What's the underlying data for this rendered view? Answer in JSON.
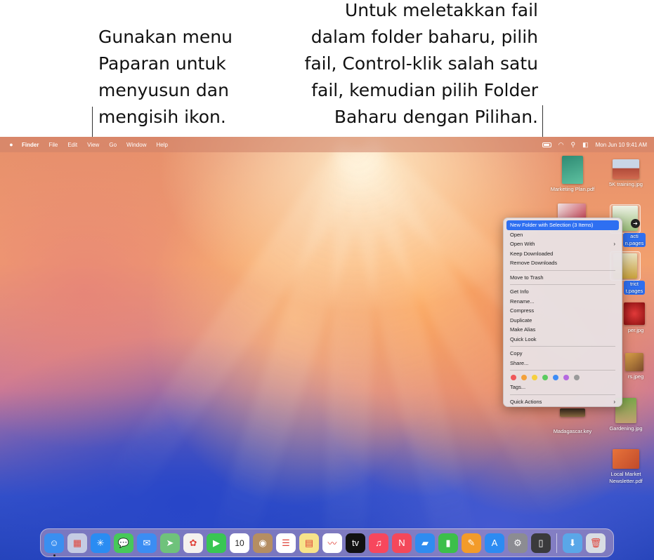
{
  "callouts": {
    "left": "Gunakan menu\nPaparan untuk\nmenyusun dan\nmengisih ikon.",
    "right": "Untuk meletakkan fail\ndalam folder baharu, pilih\nfail, Control-klik salah satu\nfail, kemudian pilih Folder\nBaharu dengan Pilihan."
  },
  "menubar": {
    "apple_icon": "apple-logo-icon",
    "items": [
      "Finder",
      "File",
      "Edit",
      "View",
      "Go",
      "Window",
      "Help"
    ],
    "status_icons": [
      "battery-icon",
      "wifi-icon",
      "spotlight-search-icon",
      "control-center-icon"
    ],
    "clock": "Mon Jun 10  9:41 AM"
  },
  "desktop_icons": [
    {
      "label": "Marketing Plan.pdf",
      "selected": false
    },
    {
      "label": "5K training.jpg",
      "selected": false
    },
    {
      "label": "acti\nn.pages",
      "selected": true
    },
    {
      "label": "trict\nt.pages",
      "selected": true
    },
    {
      "label": "per.jpg",
      "selected": false
    },
    {
      "label": "rs.jpeg",
      "selected": false
    },
    {
      "label": "Madagascar.key",
      "selected": false
    },
    {
      "label": "Gardening.jpg",
      "selected": false
    },
    {
      "label": "Local Market\nNewsletter.pdf",
      "selected": false
    }
  ],
  "context_menu": {
    "groups": [
      [
        {
          "label": "New Folder with Selection (3 Items)",
          "highlighted": true
        },
        {
          "label": "Open"
        },
        {
          "label": "Open With",
          "submenu": true
        },
        {
          "label": "Keep Downloaded"
        },
        {
          "label": "Remove Downloads"
        }
      ],
      [
        {
          "label": "Move to Trash"
        }
      ],
      [
        {
          "label": "Get Info"
        },
        {
          "label": "Rename..."
        },
        {
          "label": "Compress"
        },
        {
          "label": "Duplicate"
        },
        {
          "label": "Make Alias"
        },
        {
          "label": "Quick Look"
        }
      ],
      [
        {
          "label": "Copy"
        },
        {
          "label": "Share..."
        }
      ]
    ],
    "tag_colors": [
      "#f0575a",
      "#f4a13a",
      "#f6cf3d",
      "#5ccb5f",
      "#3d8cf6",
      "#b569e0",
      "#9a9a9a"
    ],
    "tags_label": "Tags...",
    "quick_actions_label": "Quick Actions",
    "submenu_arrow": "›"
  },
  "dock": {
    "apps": [
      {
        "name": "finder",
        "color": "#3a8ff0",
        "glyph": "☺",
        "running": true
      },
      {
        "name": "launchpad",
        "color": "#c5cbe3",
        "glyph": "▦"
      },
      {
        "name": "safari",
        "color": "#2a8cf2",
        "glyph": "✳"
      },
      {
        "name": "messages",
        "color": "#47c85a",
        "glyph": "💬"
      },
      {
        "name": "mail",
        "color": "#3b8df3",
        "glyph": "✉"
      },
      {
        "name": "maps",
        "color": "#6fc27b",
        "glyph": "➤"
      },
      {
        "name": "photos",
        "color": "#f4f1ee",
        "glyph": "✿"
      },
      {
        "name": "facetime",
        "color": "#39c653",
        "glyph": "▶"
      },
      {
        "name": "calendar",
        "color": "#ffffff",
        "glyph": "10"
      },
      {
        "name": "contacts",
        "color": "#b58e62",
        "glyph": "◉"
      },
      {
        "name": "reminders",
        "color": "#ffffff",
        "glyph": "☰"
      },
      {
        "name": "notes",
        "color": "#f7e38a",
        "glyph": "▤"
      },
      {
        "name": "freeform",
        "color": "#ffffff",
        "glyph": "〰"
      },
      {
        "name": "apple-tv",
        "color": "#111111",
        "glyph": "tv"
      },
      {
        "name": "music",
        "color": "#f7475d",
        "glyph": "♫"
      },
      {
        "name": "news",
        "color": "#f4485a",
        "glyph": "N"
      },
      {
        "name": "keynote",
        "color": "#2f8cf0",
        "glyph": "▰"
      },
      {
        "name": "numbers",
        "color": "#3cbf4a",
        "glyph": "▮"
      },
      {
        "name": "pages",
        "color": "#f39b2a",
        "glyph": "✎"
      },
      {
        "name": "app-store",
        "color": "#2c8bf2",
        "glyph": "A"
      },
      {
        "name": "system-settings",
        "color": "#8c8c92",
        "glyph": "⚙"
      },
      {
        "name": "iphone-mirroring",
        "color": "#3a3a3c",
        "glyph": "▯"
      },
      {
        "name": "downloads-folder",
        "color": "#5aa7e8",
        "glyph": "⬇"
      },
      {
        "name": "trash",
        "color": "#d9dde3",
        "glyph": "🗑"
      }
    ]
  }
}
